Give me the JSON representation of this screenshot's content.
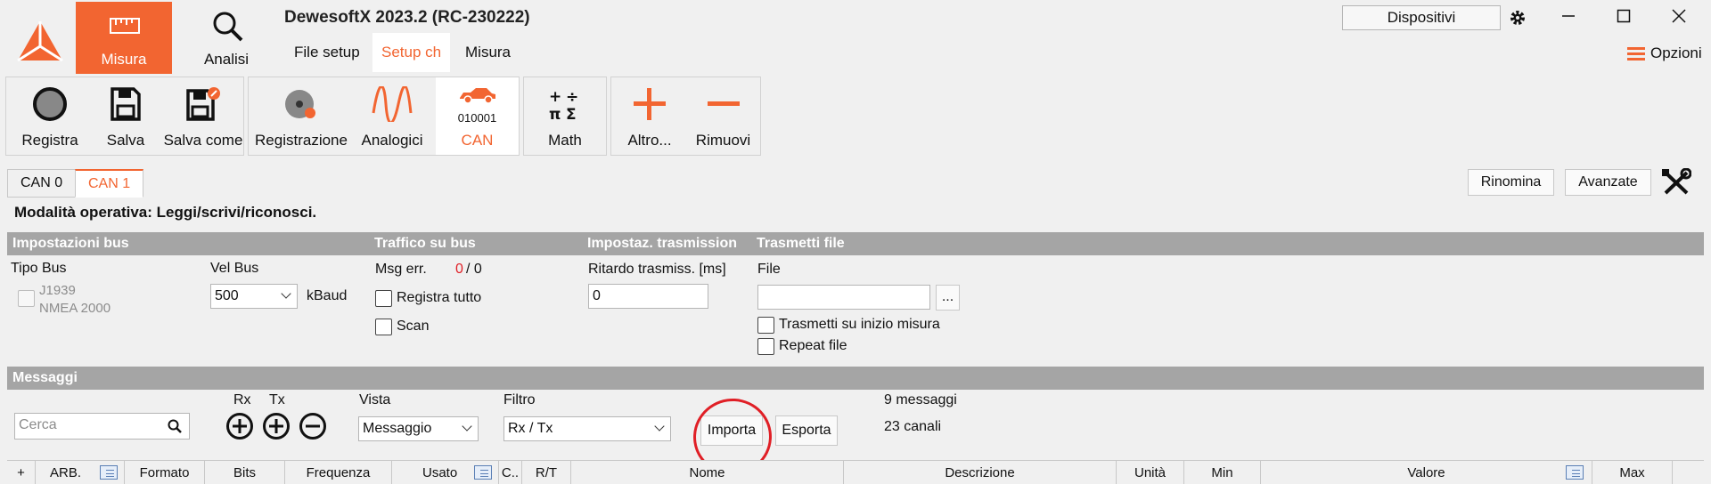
{
  "app": {
    "title": "DewesoftX 2023.2 (RC-230222)"
  },
  "modes": [
    {
      "label": "Misura",
      "active": true
    },
    {
      "label": "Analisi",
      "active": false
    }
  ],
  "subtabs": [
    {
      "label": "File setup"
    },
    {
      "label": "Setup ch",
      "active": true
    },
    {
      "label": "Misura"
    }
  ],
  "header": {
    "devices": "Dispositivi",
    "options": "Opzioni"
  },
  "toolbar": {
    "registra": "Registra",
    "salva": "Salva",
    "salva_come": "Salva come",
    "registrazione": "Registrazione",
    "analogici": "Analogici",
    "can": "CAN",
    "can_code": "010001",
    "math": "Math",
    "altro": "Altro...",
    "rimuovi": "Rimuovi"
  },
  "can_tabs": [
    {
      "label": "CAN 0"
    },
    {
      "label": "CAN 1",
      "active": true
    }
  ],
  "actions": {
    "rename": "Rinomina",
    "advanced": "Avanzate"
  },
  "operating_mode": "Modalità operativa: Leggi/scrivi/riconosci.",
  "sections": {
    "bus_settings": "Impostazioni bus",
    "bus_traffic": "Traffico su bus",
    "transmission_settings": "Impostaz. trasmission",
    "file_transmit": "Trasmetti file",
    "messages": "Messaggi"
  },
  "bus": {
    "type_label": "Tipo Bus",
    "type_options": [
      "J1939",
      "NMEA 2000"
    ],
    "speed_label": "Vel Bus",
    "speed_value": "500",
    "speed_unit": "kBaud"
  },
  "traffic": {
    "msg_err_label": "Msg err.",
    "msg_err_value": "0",
    "msg_err_total": "/ 0",
    "record_all": "Registra tutto",
    "scan": "Scan"
  },
  "transmission": {
    "delay_label": "Ritardo trasmiss. [ms]",
    "delay_value": "0"
  },
  "file_tx": {
    "file_label": "File",
    "file_value": "",
    "browse": "...",
    "on_start": "Trasmetti su inizio misura",
    "repeat": "Repeat file"
  },
  "messages": {
    "search_placeholder": "Cerca",
    "rx": "Rx",
    "tx": "Tx",
    "view_label": "Vista",
    "view_value": "Messaggio",
    "filter_label": "Filtro",
    "filter_value": "Rx / Tx",
    "import": "Importa",
    "export": "Esporta",
    "count_messages": "9 messaggi",
    "count_channels": "23 canali"
  },
  "grid_columns": [
    "+",
    "ARB.",
    "Formato",
    "Bits",
    "Frequenza",
    "Usato",
    "C..",
    "R/T",
    "Nome",
    "Descrizione",
    "Unità",
    "Min",
    "Valore",
    "Max"
  ],
  "colors": {
    "accent": "#f26531",
    "section": "#a5a5a5",
    "error": "#e01f26"
  }
}
